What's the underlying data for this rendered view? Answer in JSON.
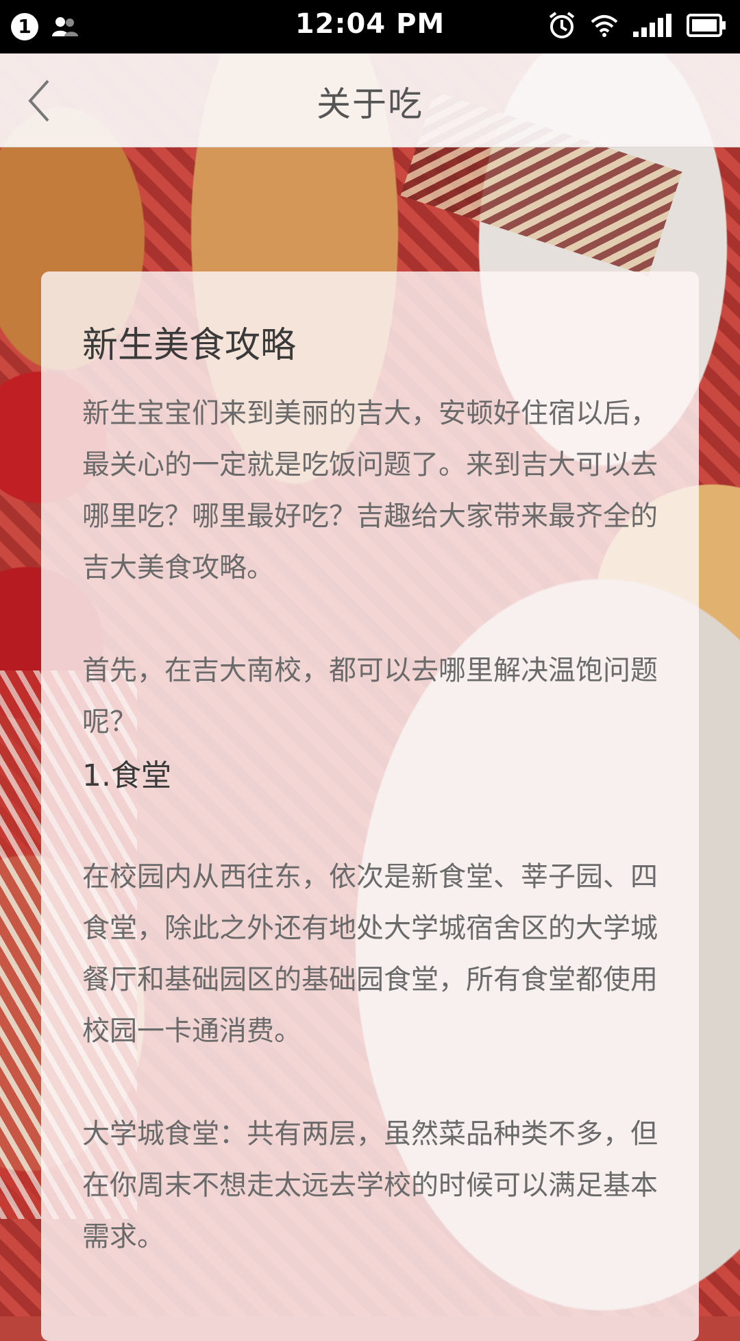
{
  "status_bar": {
    "notification_count": "1",
    "time": "12:04 PM",
    "icons": [
      "person-icon",
      "alarm-icon",
      "wifi-icon",
      "signal-icon",
      "battery-icon"
    ]
  },
  "header": {
    "title": "关于吃",
    "back_icon": "chevron-left-icon"
  },
  "article": {
    "title": "新生美食攻略",
    "intro": "新生宝宝们来到美丽的吉大，安顿好住宿以后，最关心的一定就是吃饭问题了。来到吉大可以去哪里吃？哪里最好吃？吉趣给大家带来最齐全的吉大美食攻略。",
    "question": "首先，在吉大南校，都可以去哪里解决温饱问题呢？",
    "section1_title": "1.食堂",
    "section1_para1": "在校园内从西往东，依次是新食堂、莘子园、四食堂，除此之外还有地处大学城宿舍区的大学城餐厅和基础园区的基础园食堂，所有食堂都使用校园一卡通消费。",
    "section1_para2": "大学城食堂：共有两层，虽然菜品种类不多，但在你周末不想走太远去学校的时候可以满足基本需求。"
  },
  "colors": {
    "status_bar_bg": "#000000",
    "header_bg": "#faf6f6",
    "title_text": "#555555",
    "body_text": "#6a6a6a"
  }
}
